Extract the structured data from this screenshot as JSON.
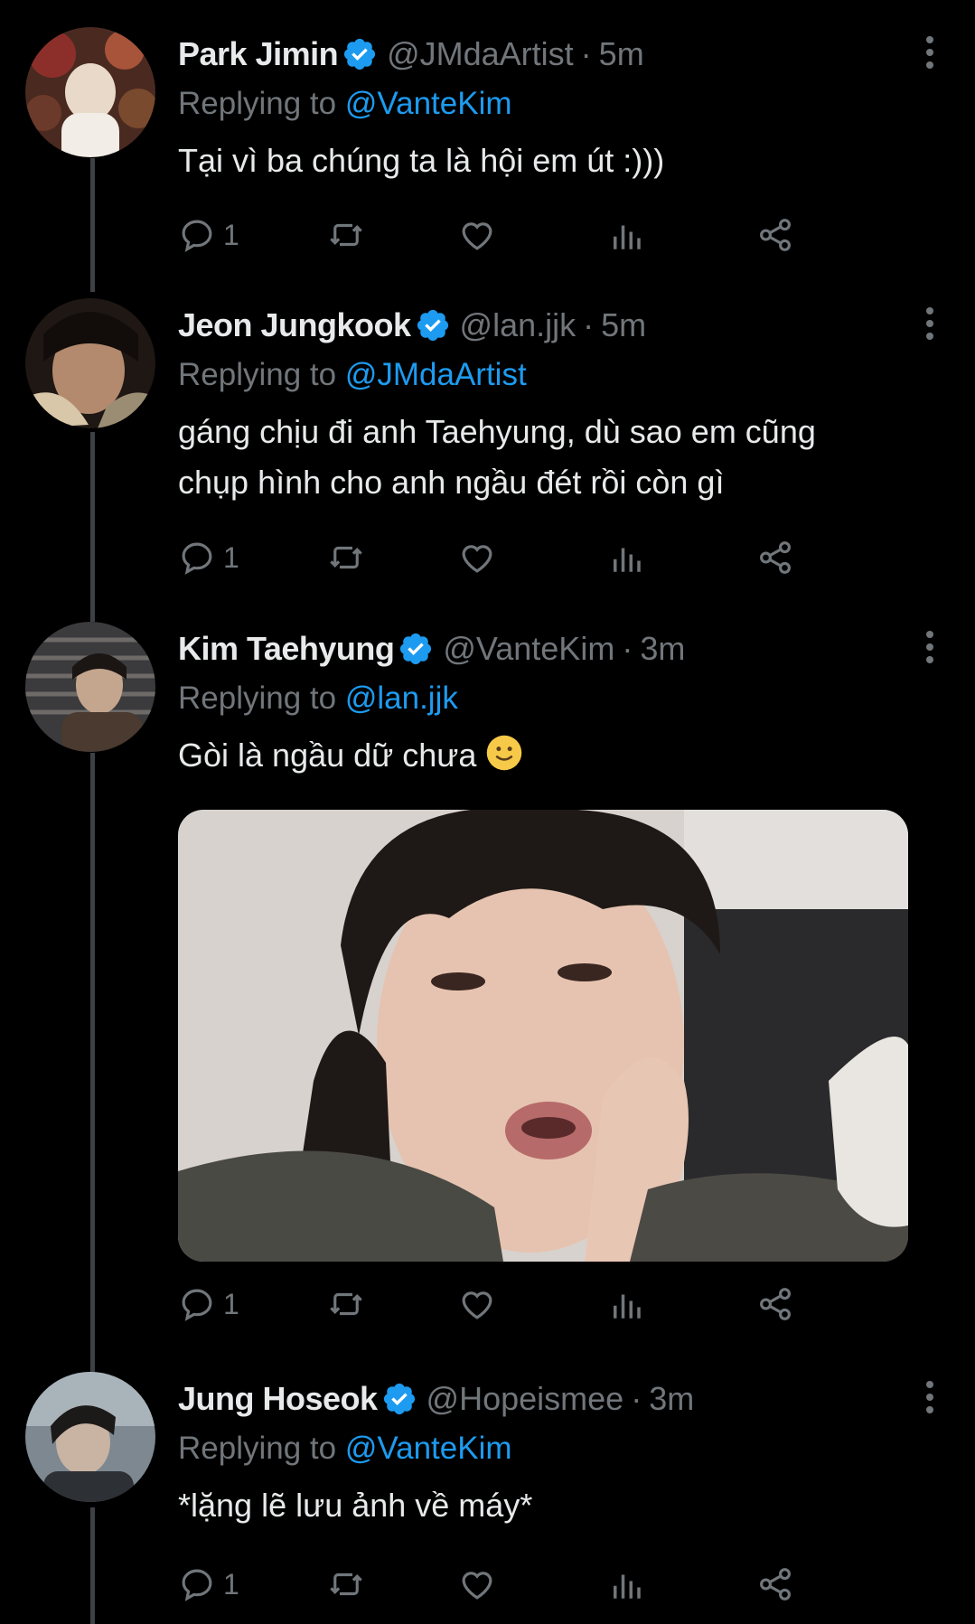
{
  "tweets": [
    {
      "name": "Park Jimin",
      "handle": "@JMdaArtist",
      "separator": "·",
      "time": "5m",
      "replying_prefix": "Replying to",
      "replying_to": "@VanteKim",
      "lines": [
        "Tại vì ba chúng ta là hội em út :)))"
      ],
      "reply_count": "1",
      "avatar_colors": [
        "#6b3a2a",
        "#c9b79a"
      ]
    },
    {
      "name": "Jeon Jungkook",
      "handle": "@lan.jjk",
      "separator": "·",
      "time": "5m",
      "replying_prefix": "Replying to",
      "replying_to": "@JMdaArtist",
      "lines": [
        "gáng chịu đi anh Taehyung, dù sao em cũng",
        "chụp hình cho anh ngầu đét rồi còn gì"
      ],
      "reply_count": "1",
      "avatar_colors": [
        "#2a1d18",
        "#b48a6e"
      ]
    },
    {
      "name": "Kim Taehyung",
      "handle": "@VanteKim",
      "separator": "·",
      "time": "3m",
      "replying_prefix": "Replying to",
      "replying_to": "@lan.jjk",
      "lines": [
        "Gòi là ngầu dữ chưa"
      ],
      "emoji": "slightly-smiling-face",
      "reply_count": "1",
      "avatar_colors": [
        "#3b3a3c",
        "#9d8a7a"
      ],
      "has_media": true
    },
    {
      "name": "Jung Hoseok",
      "handle": "@Hopeismee",
      "separator": "·",
      "time": "3m",
      "replying_prefix": "Replying to",
      "replying_to": "@VanteKim",
      "lines": [
        "*lặng lẽ lưu ảnh về máy*"
      ],
      "reply_count": "1",
      "avatar_colors": [
        "#5b6670",
        "#c2b3a5"
      ]
    }
  ],
  "icons": {
    "verified": "verified-badge-icon",
    "more": "more-vertical-icon",
    "reply": "reply-icon",
    "retweet": "retweet-icon",
    "like": "heart-icon",
    "views": "views-icon",
    "share": "share-icon"
  },
  "colors": {
    "background": "#000000",
    "text": "#e7e9ea",
    "secondary": "#71767b",
    "accent": "#1d9bf0",
    "thread_line": "#3e4144"
  }
}
